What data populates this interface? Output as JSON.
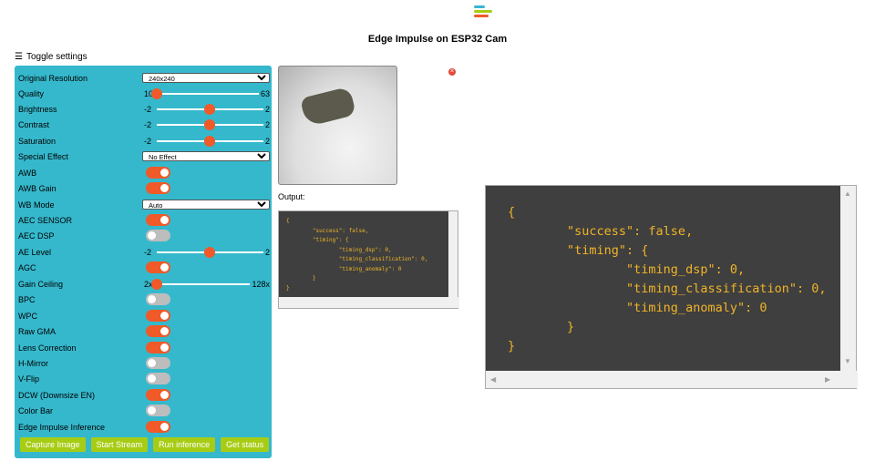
{
  "header": {
    "title": "Edge Impulse on ESP32 Cam",
    "toggle_label": "Toggle settings",
    "hamburger_glyph": "☰"
  },
  "colors": {
    "panel": "#35b8cc",
    "accent": "#f05a28",
    "button": "#a7cc14",
    "code_bg": "#3f3f3f",
    "code_text": "#f0b428"
  },
  "settings": {
    "resolution": {
      "label": "Original Resolution",
      "value": "240x240"
    },
    "quality": {
      "label": "Quality",
      "min": "10",
      "max": "63",
      "value": 10
    },
    "brightness": {
      "label": "Brightness",
      "min": "-2",
      "max": "2",
      "value": 0
    },
    "contrast": {
      "label": "Contrast",
      "min": "-2",
      "max": "2",
      "value": 0
    },
    "saturation": {
      "label": "Saturation",
      "min": "-2",
      "max": "2",
      "value": 0
    },
    "special_effect": {
      "label": "Special Effect",
      "value": "No Effect"
    },
    "awb": {
      "label": "AWB",
      "on": true
    },
    "awb_gain": {
      "label": "AWB Gain",
      "on": true
    },
    "wb_mode": {
      "label": "WB Mode",
      "value": "Auto"
    },
    "aec_sensor": {
      "label": "AEC SENSOR",
      "on": true
    },
    "aec_dsp": {
      "label": "AEC DSP",
      "on": false
    },
    "ae_level": {
      "label": "AE Level",
      "min": "-2",
      "max": "2",
      "value": 0
    },
    "agc": {
      "label": "AGC",
      "on": true
    },
    "gain_ceiling": {
      "label": "Gain Ceiling",
      "min": "2x",
      "max": "128x",
      "value": 0
    },
    "bpc": {
      "label": "BPC",
      "on": false
    },
    "wpc": {
      "label": "WPC",
      "on": true
    },
    "raw_gma": {
      "label": "Raw GMA",
      "on": true
    },
    "lens_correction": {
      "label": "Lens Correction",
      "on": true
    },
    "h_mirror": {
      "label": "H-Mirror",
      "on": false
    },
    "v_flip": {
      "label": "V-Flip",
      "on": false
    },
    "dcw": {
      "label": "DCW (Downsize EN)",
      "on": true
    },
    "color_bar": {
      "label": "Color Bar",
      "on": false
    },
    "ei_inference": {
      "label": "Edge Impulse Inference",
      "on": true
    }
  },
  "buttons": {
    "capture": "Capture Image",
    "stream": "Start Stream",
    "inference": "Run inference",
    "status": "Get status"
  },
  "output": {
    "label": "Output:",
    "json_text": "{\n        \"success\": false,\n        \"timing\": {\n                \"timing_dsp\": 0,\n                \"timing_classification\": 0,\n                \"timing_anomaly\": 0\n        }\n}"
  },
  "icons": {
    "close": "×",
    "scroll_up": "▲",
    "scroll_down": "▼",
    "scroll_left": "◀",
    "scroll_right": "▶"
  }
}
